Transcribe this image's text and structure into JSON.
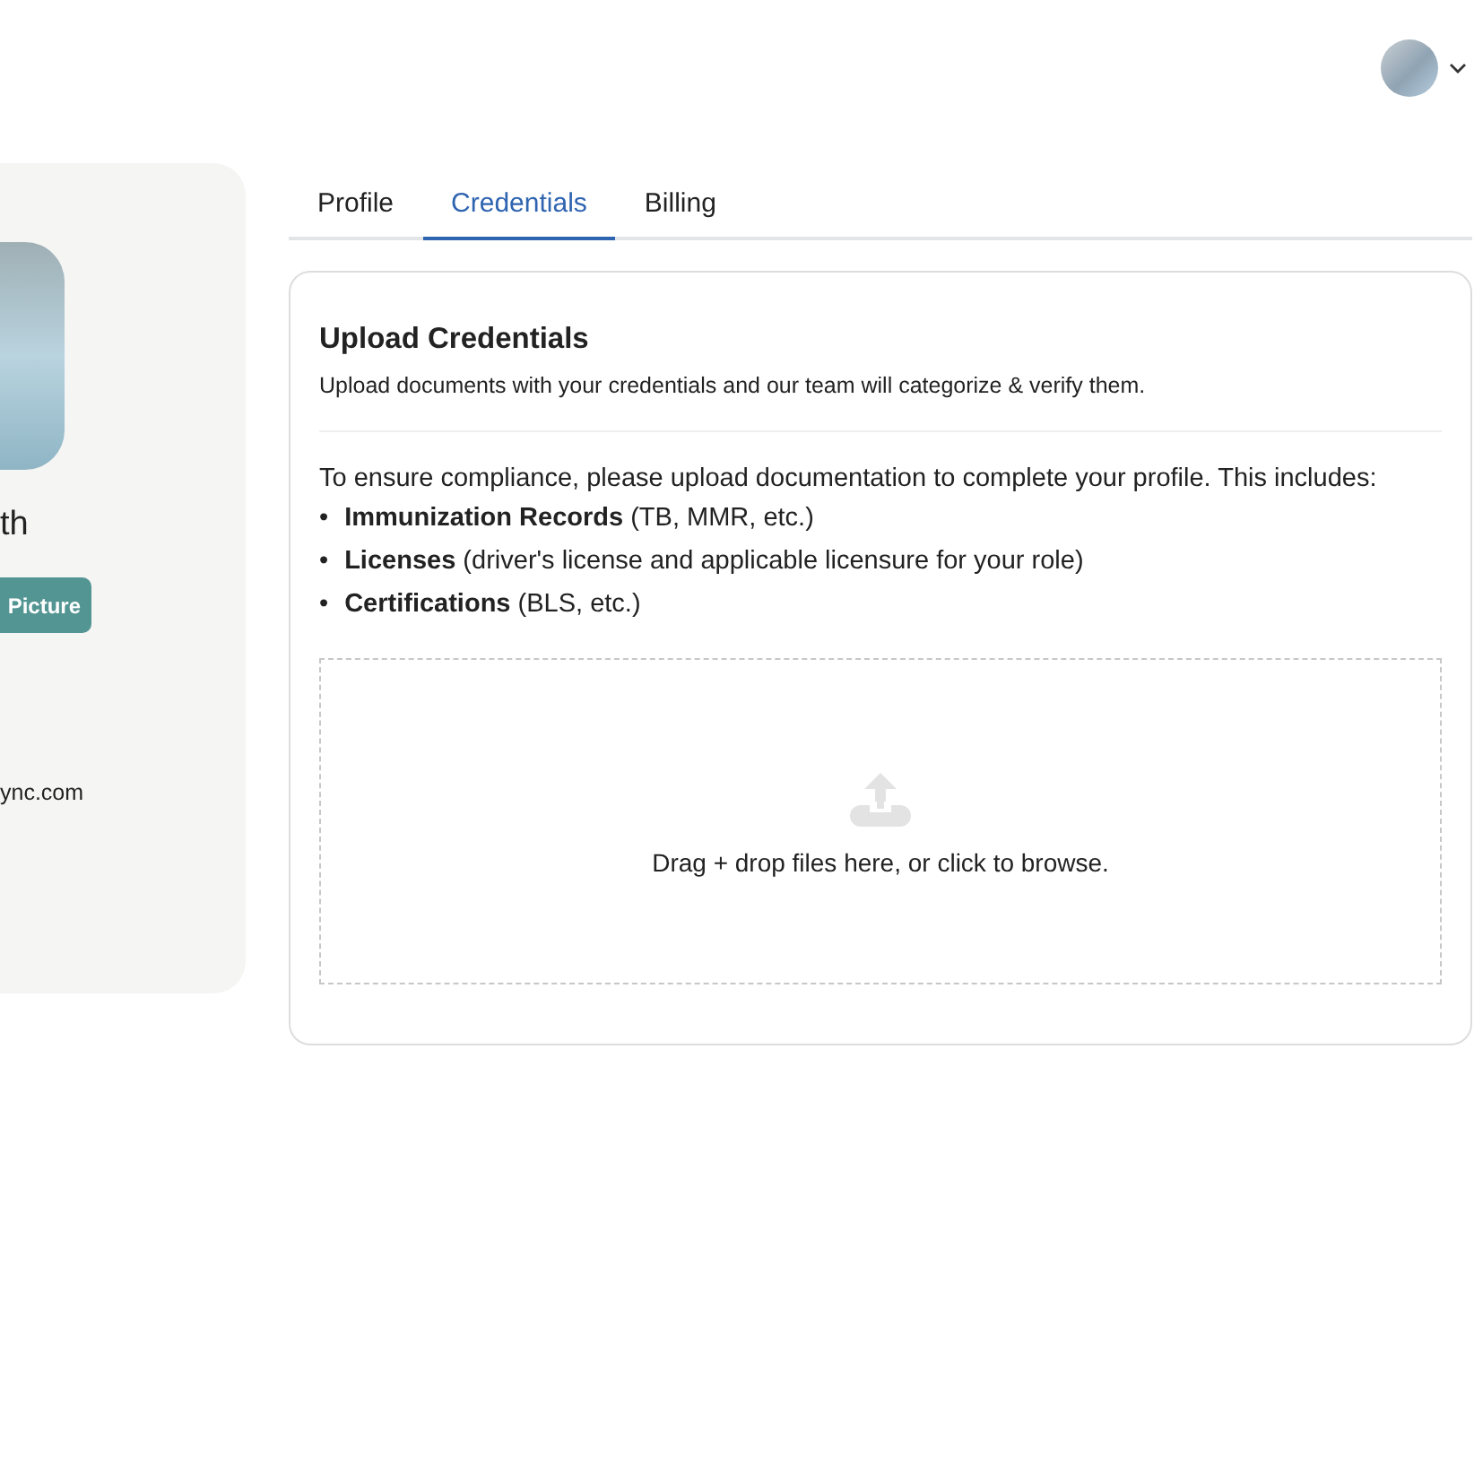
{
  "header": {
    "account_menu": {
      "expanded": false
    }
  },
  "profile_card": {
    "name": "th",
    "button": "Picture",
    "email": "ync.com"
  },
  "tabs": [
    {
      "label": "Profile",
      "selected": false
    },
    {
      "label": "Credentials",
      "selected": true
    },
    {
      "label": "Billing",
      "selected": false
    }
  ],
  "upload_card": {
    "title": "Upload Credentials",
    "subtitle": "Upload documents with your credentials and our team will categorize & verify them.",
    "intro": "To ensure compliance, please upload documentation to complete your profile. This includes:",
    "items": [
      {
        "bullet": "•",
        "text": "**Immunization Records** (TB, MMR, etc.)"
      },
      {
        "bullet": "•",
        "text": "**Licenses** (driver's license and applicable licensure for your role)"
      },
      {
        "bullet": "•",
        "text": "**Certifications** (BLS, etc.)"
      }
    ],
    "dropzone": "Drag + drop files here, or click to browse."
  }
}
